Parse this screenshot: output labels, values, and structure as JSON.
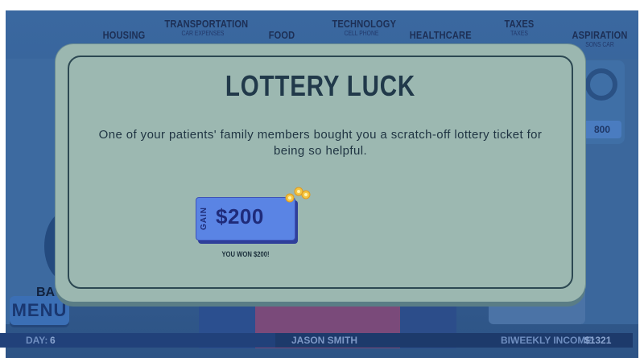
{
  "categories": [
    {
      "name": "HOUSING",
      "sub": ""
    },
    {
      "name": "TRANSPORTATION",
      "sub": "CAR EXPENSES"
    },
    {
      "name": "FOOD",
      "sub": ""
    },
    {
      "name": "TECHNOLOGY",
      "sub": "CELL PHONE"
    },
    {
      "name": "HEALTHCARE",
      "sub": ""
    },
    {
      "name": "TAXES",
      "sub": "TAXES"
    },
    {
      "name": "ASPIRATION",
      "sub": "SONS CAR"
    }
  ],
  "aspiration_widget": {
    "price_partial": "800"
  },
  "modal": {
    "title": "LOTTERY LUCK",
    "body": "One of your patients' family members bought you a scratch-off lottery ticket for being so helpful.",
    "gain_tag": "GAIN",
    "gain_amount": "$200",
    "caption": "YOU WON $200!"
  },
  "left_panel": {
    "label_partial": "BA",
    "menu_label": "MENU"
  },
  "status_bar": {
    "day_label": "DAY:",
    "day_value": "6",
    "player_name": "JASON SMITH",
    "income_label": "BIWEEKLY INCOME:",
    "income_value": "$1321"
  },
  "colors": {
    "modal_bg": "#9bb7b0",
    "card_blue": "#5a84e4",
    "title_text": "#21394a",
    "background_scene": "#2f5f96"
  }
}
